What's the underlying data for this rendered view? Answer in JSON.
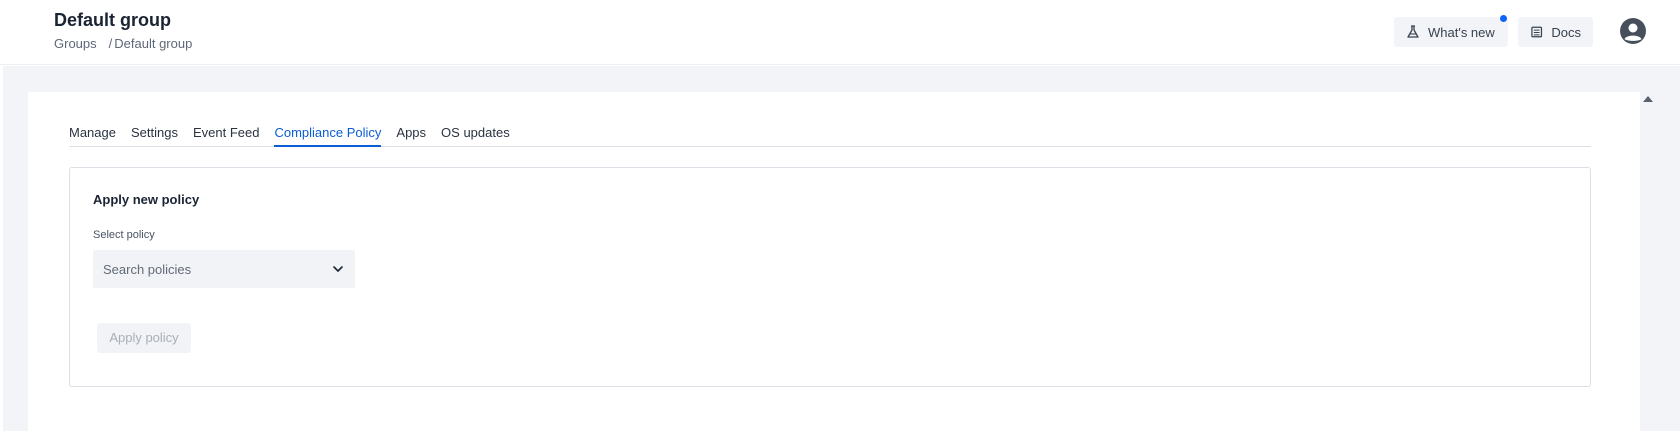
{
  "header": {
    "menu_glyph": ":",
    "title": "Default group",
    "breadcrumb": {
      "parent": "Groups",
      "separator": "/",
      "current": "Default group"
    },
    "whats_new_label": "What's new",
    "docs_label": "Docs",
    "notification_color": "#0f62fe"
  },
  "tabs": [
    {
      "label": "Manage",
      "active": false
    },
    {
      "label": "Settings",
      "active": false
    },
    {
      "label": "Event Feed",
      "active": false
    },
    {
      "label": "Compliance Policy",
      "active": true
    },
    {
      "label": "Apps",
      "active": false
    },
    {
      "label": "OS updates",
      "active": false
    }
  ],
  "policy_form": {
    "title": "Apply new policy",
    "select_label": "Select policy",
    "select_placeholder": "Search policies",
    "apply_label": "Apply policy",
    "apply_disabled": true
  },
  "colors": {
    "accent": "#0b5cd5",
    "page_bg": "#f3f4f8"
  },
  "icons": {
    "whats_new": "flask-icon",
    "docs": "book-icon",
    "avatar": "user-avatar-icon",
    "select": "chevron-down-icon",
    "scroll": "scroll-up-arrow-icon"
  }
}
